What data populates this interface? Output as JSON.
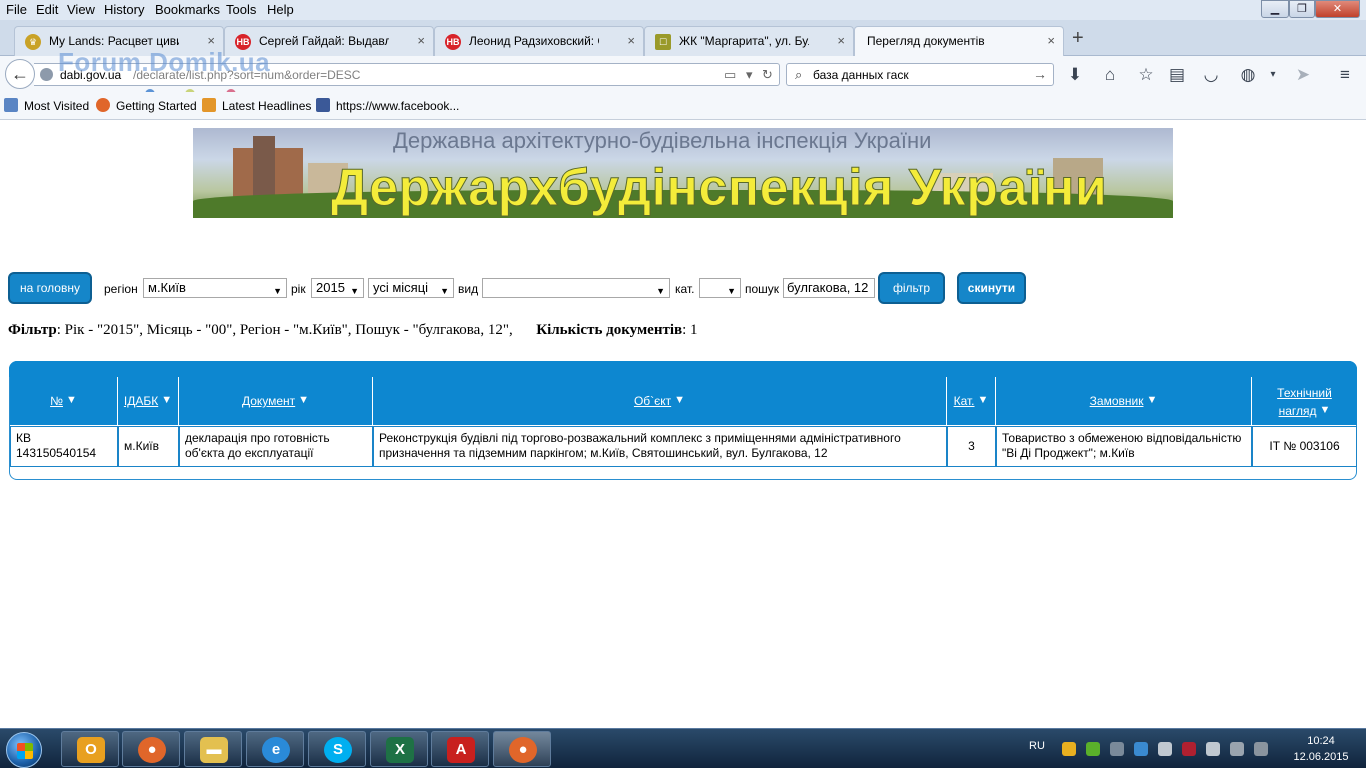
{
  "browser": {
    "menu": [
      "File",
      "Edit",
      "View",
      "History",
      "Bookmarks",
      "Tools",
      "Help"
    ],
    "tabs": [
      {
        "title": "My Lands: Расцвет цивил...",
        "close": "×"
      },
      {
        "title": "Сергей Гайдай: Выдавлив...",
        "close": "×",
        "badge": "НВ"
      },
      {
        "title": "Леонид Радзиховский: О ...",
        "close": "×",
        "badge": "НВ"
      },
      {
        "title": "ЖК \"Маргарита\", ул. Булг...",
        "close": "×"
      },
      {
        "title": "Перегляд документів",
        "close": "×"
      }
    ],
    "url_host": "dabi.gov.ua",
    "url_path": "/declarate/list.php?sort=num&order=DESC",
    "watermark": "Forum.Domik.ua",
    "search_text": "база данных гаск",
    "bookmarks": [
      "Most Visited",
      "Getting Started",
      "Latest Headlines",
      "https://www.facebook..."
    ]
  },
  "banner": {
    "subtitle": "Державна архітектурно-будівельна інспекція України",
    "title": "Держархбудінспекція України"
  },
  "filters": {
    "home_button": "на головну",
    "region_label": "регіон",
    "region_value": "м.Київ",
    "year_label": "рік",
    "year_value": "2015",
    "month_value": "усі місяці",
    "type_label": "вид",
    "type_value": "",
    "cat_label": "кат.",
    "cat_value": "",
    "search_label": "пошук",
    "search_value": "булгакова, 12",
    "filter_button": "фільтр",
    "reset_button": "скинути"
  },
  "summary": {
    "filter_label": "Фільтр",
    "filter_text": ": Рік - \"2015\", Місяць - \"00\", Регіон - \"м.Київ\", Пошук - \"булгакова, 12\",",
    "count_label": "Кількість документів",
    "count_text": ": 1"
  },
  "table": {
    "headers": [
      "№",
      "ІДАБК",
      "Документ",
      "Об`єкт",
      "Кат.",
      "Замовник",
      "Технічний нагляд"
    ],
    "rows": [
      {
        "num": "КВ 143150540154",
        "idabk": "м.Київ",
        "document": "декларація про готовність об'єкта до експлуатації",
        "object": "Реконструкція будівлі під торгово-розважальний комплекс з приміщеннями адміністративного призначення та підземним паркінгом; м.Київ, Святошинський, вул. Булгакова, 12",
        "cat": "3",
        "customer": "Товариство з обмеженою відповідальністю \"Ві Ді Проджект\"; м.Київ",
        "supervision": "ІТ № 003106"
      }
    ]
  },
  "taskbar": {
    "lang": "RU",
    "time": "10:24",
    "date": "12.06.2015"
  },
  "colors": {
    "accent_blue": "#0d87d0",
    "button_blue": "#1586c9",
    "banner_title": "#f4ec3a"
  }
}
